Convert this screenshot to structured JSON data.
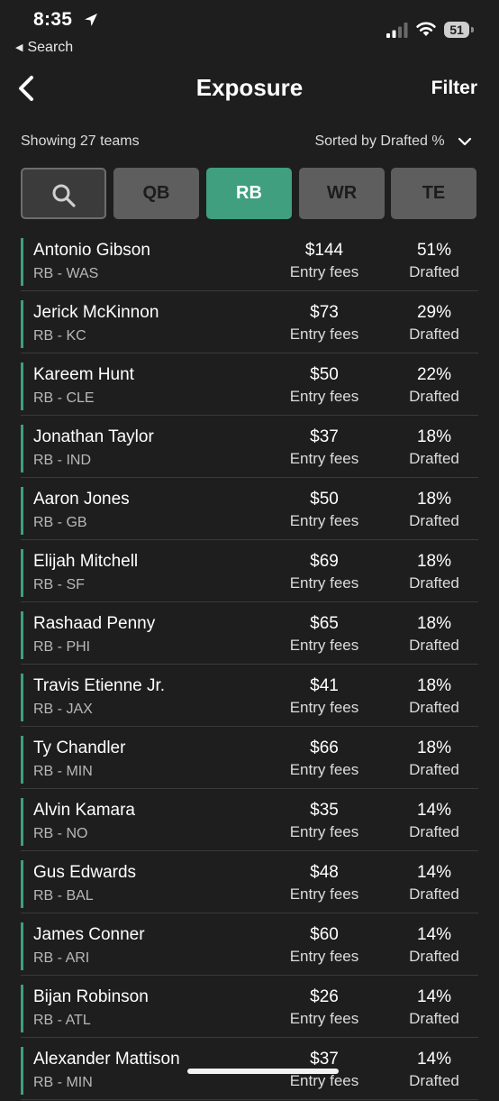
{
  "status_bar": {
    "time": "8:35",
    "back_label": "Search",
    "battery": "51"
  },
  "nav": {
    "title": "Exposure",
    "filter_label": "Filter"
  },
  "summary": {
    "showing": "Showing 27 teams",
    "sort_label": "Sorted by Drafted %"
  },
  "tabs": [
    {
      "label": ""
    },
    {
      "label": "QB"
    },
    {
      "label": "RB",
      "active": true
    },
    {
      "label": "WR"
    },
    {
      "label": "TE"
    }
  ],
  "accent_color": "#3f9f7e",
  "rows": [
    {
      "name": "Antonio Gibson",
      "pos": "RB - WAS",
      "fee": "$144",
      "fee_label": "Entry fees",
      "pct": "51%",
      "pct_label": "Drafted"
    },
    {
      "name": "Jerick McKinnon",
      "pos": "RB - KC",
      "fee": "$73",
      "fee_label": "Entry fees",
      "pct": "29%",
      "pct_label": "Drafted"
    },
    {
      "name": "Kareem Hunt",
      "pos": "RB - CLE",
      "fee": "$50",
      "fee_label": "Entry fees",
      "pct": "22%",
      "pct_label": "Drafted"
    },
    {
      "name": "Jonathan Taylor",
      "pos": "RB - IND",
      "fee": "$37",
      "fee_label": "Entry fees",
      "pct": "18%",
      "pct_label": "Drafted"
    },
    {
      "name": "Aaron Jones",
      "pos": "RB - GB",
      "fee": "$50",
      "fee_label": "Entry fees",
      "pct": "18%",
      "pct_label": "Drafted"
    },
    {
      "name": "Elijah Mitchell",
      "pos": "RB - SF",
      "fee": "$69",
      "fee_label": "Entry fees",
      "pct": "18%",
      "pct_label": "Drafted"
    },
    {
      "name": "Rashaad Penny",
      "pos": "RB - PHI",
      "fee": "$65",
      "fee_label": "Entry fees",
      "pct": "18%",
      "pct_label": "Drafted"
    },
    {
      "name": "Travis Etienne Jr.",
      "pos": "RB - JAX",
      "fee": "$41",
      "fee_label": "Entry fees",
      "pct": "18%",
      "pct_label": "Drafted"
    },
    {
      "name": "Ty Chandler",
      "pos": "RB - MIN",
      "fee": "$66",
      "fee_label": "Entry fees",
      "pct": "18%",
      "pct_label": "Drafted"
    },
    {
      "name": "Alvin Kamara",
      "pos": "RB - NO",
      "fee": "$35",
      "fee_label": "Entry fees",
      "pct": "14%",
      "pct_label": "Drafted"
    },
    {
      "name": "Gus Edwards",
      "pos": "RB - BAL",
      "fee": "$48",
      "fee_label": "Entry fees",
      "pct": "14%",
      "pct_label": "Drafted"
    },
    {
      "name": "James Conner",
      "pos": "RB - ARI",
      "fee": "$60",
      "fee_label": "Entry fees",
      "pct": "14%",
      "pct_label": "Drafted"
    },
    {
      "name": "Bijan Robinson",
      "pos": "RB - ATL",
      "fee": "$26",
      "fee_label": "Entry fees",
      "pct": "14%",
      "pct_label": "Drafted"
    },
    {
      "name": "Alexander Mattison",
      "pos": "RB - MIN",
      "fee": "$37",
      "fee_label": "Entry fees",
      "pct": "14%",
      "pct_label": "Drafted"
    }
  ]
}
